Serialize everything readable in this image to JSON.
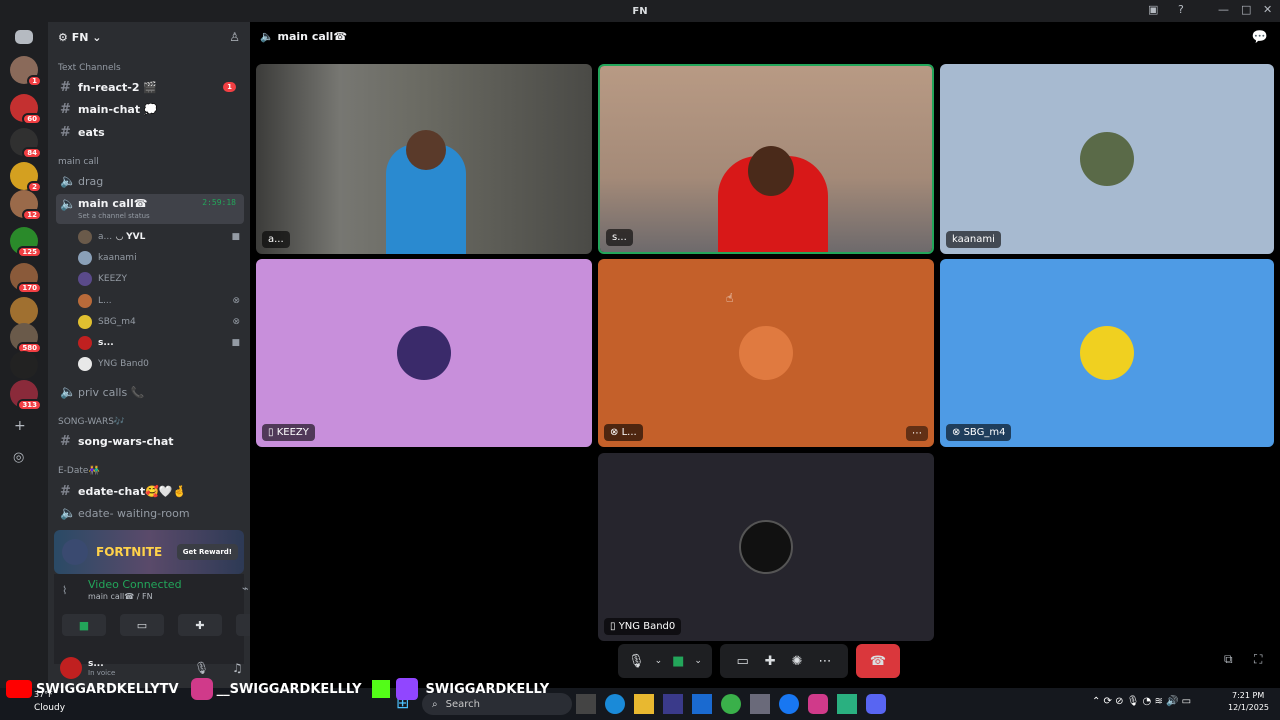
{
  "window": {
    "title": "FN"
  },
  "guilds": [
    {
      "badge": "1",
      "color": "#8a6a5a"
    },
    {
      "badge": "60",
      "color": "#c43030"
    },
    {
      "badge": "84",
      "color": "#303030"
    },
    {
      "badge": "2",
      "color": "#d4a020"
    },
    {
      "badge": "12",
      "color": "#9a6a4a"
    },
    {
      "badge": "125",
      "color": "#2a8a2a"
    },
    {
      "badge": "170",
      "color": "#8a5a3a"
    },
    {
      "badge": "",
      "color": "#a07030"
    },
    {
      "badge": "580",
      "color": "#6a5a4a"
    },
    {
      "badge": "",
      "color": "#222"
    },
    {
      "badge": "313",
      "color": "#8a2a3a"
    }
  ],
  "server": {
    "name": "FN"
  },
  "categories": {
    "text": "Text Channels",
    "maincall": "main call",
    "songwars": "SONG-WARS🎶",
    "edate": "E-Date👫"
  },
  "channels": {
    "fnreact": "fn-react-2 🎬",
    "fnreact_badge": "1",
    "mainchat": "main-chat 💭",
    "eats": "eats",
    "drag": "drag",
    "maincall": "main call☎",
    "maincall_time": "2:59:18",
    "status": "Set a channel status",
    "priv": "priv calls 📞",
    "songwars": "song-wars-chat",
    "edatechat": "edate-chat🥰🤍🤞",
    "waiting": "edate- waiting-room"
  },
  "voice_users": [
    {
      "name": "a...",
      "extra": "◡ YVL",
      "color": "#6a5a4a"
    },
    {
      "name": "kaanami",
      "extra": "",
      "color": "#8aa0b8"
    },
    {
      "name": "KEEZY",
      "extra": "",
      "color": "#5a4a8a"
    },
    {
      "name": "L...",
      "extra": "",
      "color": "#b86a3a"
    },
    {
      "name": "SBG_m4",
      "extra": "",
      "color": "#e0c030"
    },
    {
      "name": "s...",
      "extra": "",
      "color": "#c02020"
    },
    {
      "name": "YNG Band0",
      "extra": "",
      "color": "#e8e8e8"
    }
  ],
  "promo": {
    "game": "FORTNITE",
    "button": "Get Reward!"
  },
  "voice": {
    "status": "Video Connected",
    "location": "main call☎ / FN"
  },
  "user": {
    "name": "s...",
    "sub": "In voice"
  },
  "call": {
    "title": "main call☎"
  },
  "tiles": [
    {
      "label": "a...",
      "color": "#5d5d58"
    },
    {
      "label": "s...",
      "color": "#8a7466"
    },
    {
      "label": "kaanami",
      "color": "#a7bad0"
    },
    {
      "label": "KEEZY",
      "color": "#c88fdb"
    },
    {
      "label": "L...",
      "color": "#c4602a"
    },
    {
      "label": "SBG_m4",
      "color": "#4e9be5"
    },
    {
      "label": "YNG Band0",
      "color": "#26252d"
    }
  ],
  "overlay": {
    "yt": "SWIGGARDKELLYTV",
    "ig": "__SWIGGARDKELLLY",
    "tw": "SWIGGARDKELLY"
  },
  "taskbar": {
    "weather": "Cloudy",
    "temp": "37°F",
    "search": "Search",
    "time": "7:21 PM",
    "date": "12/1/2025"
  }
}
